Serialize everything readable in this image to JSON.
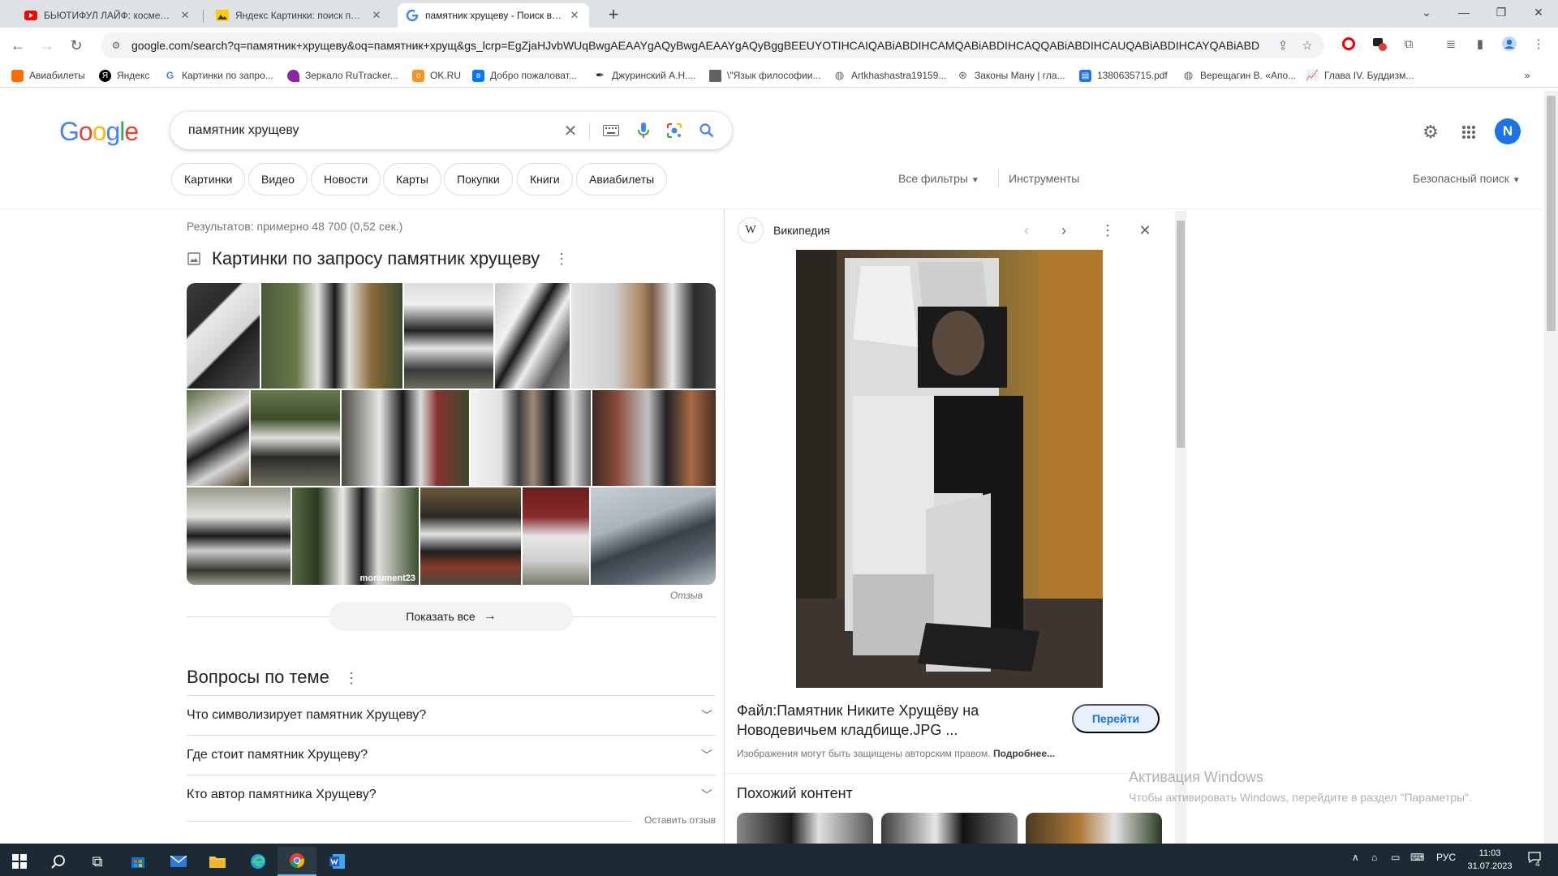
{
  "browser": {
    "tabs": [
      {
        "title": "БЬЮТИФУЛ ЛАЙФ: косметолог",
        "icon": "youtube-icon",
        "active": false
      },
      {
        "title": "Яндекс Картинки: поиск похож",
        "icon": "yandex-images-icon",
        "active": false
      },
      {
        "title": "памятник хрущеву - Поиск в Google",
        "icon": "google-icon",
        "active": true
      }
    ],
    "new_tab": "+",
    "url": "google.com/search?q=памятник+хрущеву&oq=памятник+хрущ&gs_lcrp=EgZjaHJvbWUqBwgAEAAYgAQyBwgAEAAYgAQyBggBEEUYOTIHCAIQABiABDIHCAMQABiABDIHCAQQABiABDIHCAUQABiABDIHCAYQABiABDIHCAcQA",
    "bookmarks": [
      {
        "label": "Авиабилеты",
        "icon": "aviasales-icon",
        "color": "#ff6d00"
      },
      {
        "label": "Яндекс",
        "icon": "yandex-icon",
        "color": "#000000"
      },
      {
        "label": "Картинки по запро...",
        "icon": "google-icon",
        "color": "#4285f4"
      },
      {
        "label": "Зеркало RuTracker...",
        "icon": "rutracker-icon",
        "color": "#8e24aa"
      },
      {
        "label": "OK.RU",
        "icon": "ok-icon",
        "color": "#f7931e"
      },
      {
        "label": "Добро пожаловат...",
        "icon": "vk-icon",
        "color": "#0077ff"
      },
      {
        "label": "Джуринский А.Н....",
        "icon": "pen-icon",
        "color": "#202124"
      },
      {
        "label": "\\\"Язык философии...",
        "icon": "book-icon",
        "color": "#5f6368"
      },
      {
        "label": "Artkhashastra19159...",
        "icon": "globe-icon",
        "color": "#5f6368"
      },
      {
        "label": "Законы Ману | гла...",
        "icon": "compass-icon",
        "color": "#5f6368"
      },
      {
        "label": "1380635715.pdf",
        "icon": "pdf-icon",
        "color": "#1a73e8"
      },
      {
        "label": "Верещагин В. «Апо...",
        "icon": "globe-icon",
        "color": "#5f6368"
      },
      {
        "label": "Глава IV. Буддизм...",
        "icon": "chart-icon",
        "color": "#202124"
      }
    ]
  },
  "google": {
    "logo": [
      "G",
      "o",
      "o",
      "g",
      "l",
      "e"
    ],
    "logo_colors": [
      "#4285f4",
      "#ea4335",
      "#fbbc05",
      "#4285f4",
      "#34a853",
      "#ea4335"
    ],
    "query": "памятник хрущеву",
    "account_initial": "N",
    "chips": [
      "Картинки",
      "Видео",
      "Новости",
      "Карты",
      "Покупки",
      "Книги",
      "Авиабилеты"
    ],
    "all_filters": "Все фильтры",
    "tools": "Инструменты",
    "safe_search": "Безопасный поиск"
  },
  "results": {
    "stats": "Результатов: примерно 48 700 (0,52 сек.)",
    "images_heading": "Картинки по запросу памятник хрущеву",
    "watermark": "monument23",
    "feedback": "Отзыв",
    "show_all": "Показать все",
    "paa_title": "Вопросы по теме",
    "paa": [
      "Что символизирует памятник Хрущеву?",
      "Где стоит памятник Хрущеву?",
      "Кто автор памятника Хрущеву?"
    ],
    "leave_feedback": "Оставить отзыв"
  },
  "panel": {
    "source": "Википедия",
    "source_icon": "W",
    "title": "Файл:Памятник Никите Хрущёву на Новодевичьем кладбище.JPG ...",
    "goto": "Перейти",
    "copyright": "Изображения могут быть защищены авторским правом.",
    "more": "Подробнее...",
    "similar": "Похожий контент"
  },
  "activation": {
    "title": "Активация Windows",
    "text": "Чтобы активировать Windows, перейдите в раздел \"Параметры\"."
  },
  "taskbar": {
    "lang": "РУС",
    "time": "11:03",
    "date": "31.07.2023",
    "notifications": "4"
  }
}
